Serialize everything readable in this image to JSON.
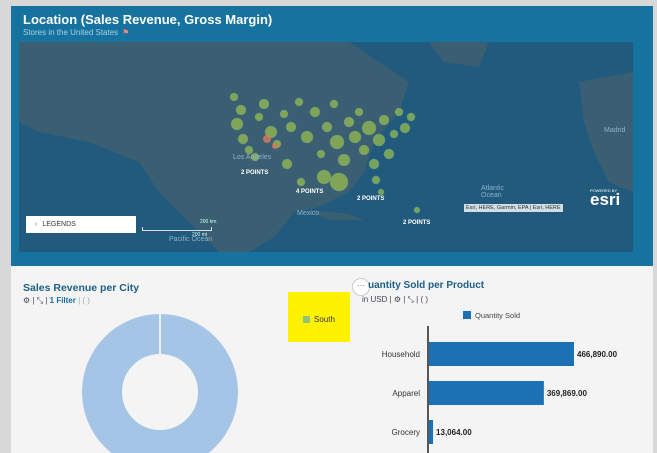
{
  "map": {
    "title": "Location (Sales Revenue, Gross Margin)",
    "subtitle": "Stores in the United States",
    "points_labels": [
      "2 POINTS",
      "4 POINTS",
      "2 POINTS",
      "2 POINTS"
    ],
    "places": [
      "Los Angeles",
      "Mexico",
      "Atlantic Ocean",
      "Pacific Ocean",
      "Madrid"
    ],
    "legends_label": "LEGENDS",
    "scale_top": "200 km",
    "scale_bottom": "200 mi",
    "attribution": "Esri, HERE, Garmin, EPA | Esri, HERE",
    "brand": "esri",
    "brand_small": "POWERED BY"
  },
  "sales": {
    "title": "Sales Revenue per City",
    "filter_label": "1 Filter",
    "toolbar_prefix": "⚙ | ⤡ |",
    "toolbar_suffix": "| ( )"
  },
  "highlight": {
    "label": "South",
    "color": "#90c37a"
  },
  "more_label": "···",
  "quantity": {
    "title": "Quantity Sold per Product",
    "title_visible": "uantity Sold per Product",
    "toolbar": "in USD | ⚙ | ⤡ | ( )",
    "legend_label": "Quantity  Sold"
  },
  "chart_data": {
    "type": "bar",
    "orientation": "horizontal",
    "categories": [
      "Household",
      "Apparel",
      "Grocery"
    ],
    "series": [
      {
        "name": "Quantity  Sold",
        "values": [
          466890.0,
          369869.0,
          13064.0
        ]
      }
    ],
    "value_labels": [
      "466,890.00",
      "369,869.00",
      "13,064.00"
    ],
    "title": "Quantity Sold per Product",
    "color": "#1b71b3"
  }
}
